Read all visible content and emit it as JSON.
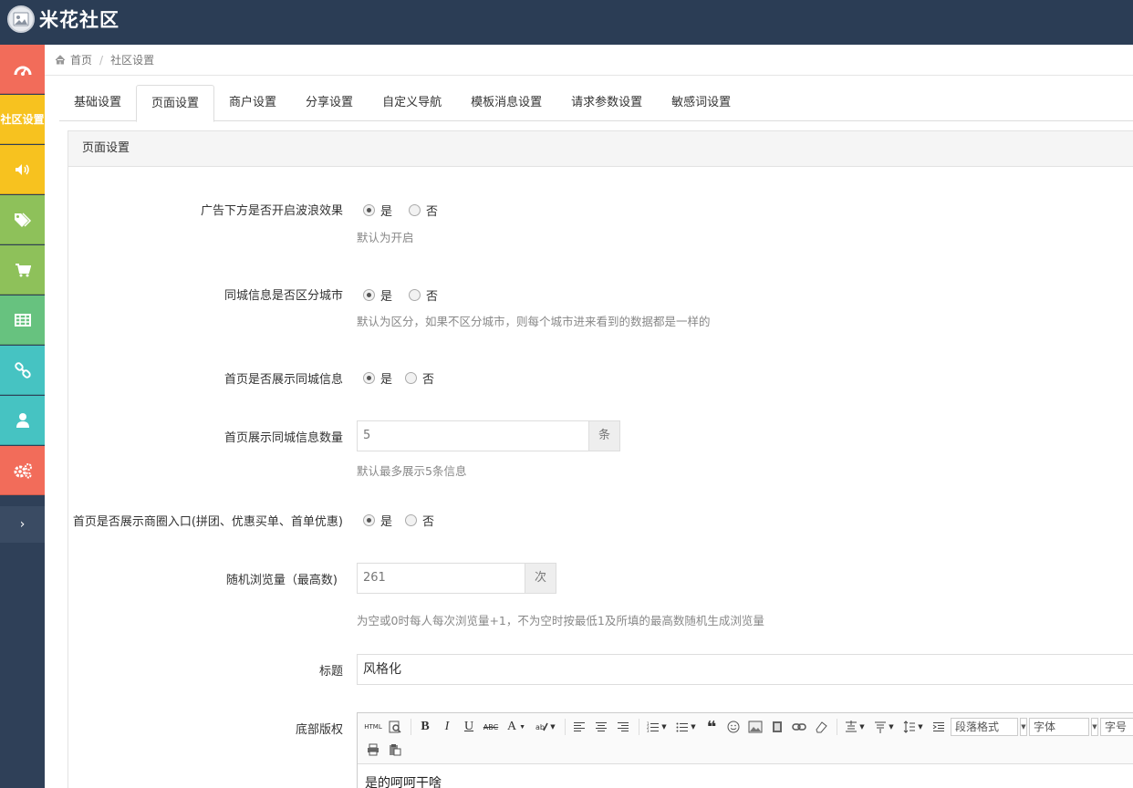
{
  "header": {
    "app_name": "米花社区"
  },
  "sidebar": {
    "items": [
      {
        "icon": "dashboard-icon",
        "color": "#f26c5a",
        "label": ""
      },
      {
        "icon": "",
        "color": "#f7c21f",
        "label": "社区设置"
      },
      {
        "icon": "volume-icon",
        "color": "#f7c21f",
        "label": ""
      },
      {
        "icon": "tags-icon",
        "color": "#8ec15a",
        "label": ""
      },
      {
        "icon": "cart-icon",
        "color": "#8ec15a",
        "label": ""
      },
      {
        "icon": "table-icon",
        "color": "#67c27f",
        "label": ""
      },
      {
        "icon": "link-icon",
        "color": "#46c3c2",
        "label": ""
      },
      {
        "icon": "user-icon",
        "color": "#46c3c2",
        "label": ""
      },
      {
        "icon": "gears-icon",
        "color": "#f26c5a",
        "label": ""
      }
    ],
    "toggle": "›"
  },
  "breadcrumb": {
    "home": "首页",
    "separator": "/",
    "current": "社区设置"
  },
  "tabs": [
    "基础设置",
    "页面设置",
    "商户设置",
    "分享设置",
    "自定义导航",
    "模板消息设置",
    "请求参数设置",
    "敏感词设置"
  ],
  "active_tab": "页面设置",
  "panel": {
    "title": "页面设置"
  },
  "form": {
    "wave": {
      "label": "广告下方是否开启波浪效果",
      "yes": "是",
      "no": "否",
      "help": "默认为开启"
    },
    "city": {
      "label": "同城信息是否区分城市",
      "yes": "是",
      "no": "否",
      "help": "默认为区分，如果不区分城市，则每个城市进来看到的数据都是一样的"
    },
    "home_show": {
      "label": "首页是否展示同城信息",
      "yes": "是",
      "no": "否"
    },
    "home_count": {
      "label": "首页展示同城信息数量",
      "value": "5",
      "unit": "条",
      "help": "默认最多展示5条信息"
    },
    "business_entry": {
      "label": "首页是否展示商圈入口(拼团、优惠买单、首单优惠)",
      "yes": "是",
      "no": "否"
    },
    "random_views": {
      "label": "随机浏览量（最高数)",
      "value": "261",
      "unit": "次",
      "help": "为空或0时每人每次浏览量+1，不为空时按最低1及所填的最高数随机生成浏览量"
    },
    "title": {
      "label": "标题",
      "value": "风格化"
    },
    "footer": {
      "label": "底部版权",
      "content": "是的呵呵干啥"
    }
  },
  "editor_toolbar": {
    "html": "HTML",
    "bold": "B",
    "italic": "I",
    "underline": "U",
    "strike": "ABC",
    "fontcolor": "A",
    "quote": "❝",
    "paragraph": "段落格式",
    "font": "字体",
    "size": "字号"
  }
}
